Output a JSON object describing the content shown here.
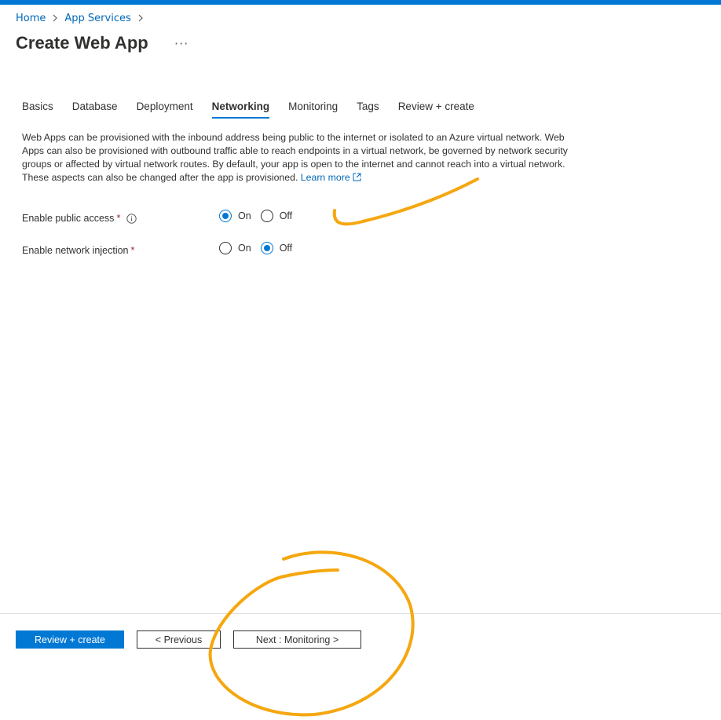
{
  "breadcrumb": {
    "home": "Home",
    "app_services": "App Services",
    "sep": ">"
  },
  "page": {
    "title": "Create Web App",
    "more": "···"
  },
  "tabs": [
    {
      "label": "Basics"
    },
    {
      "label": "Database"
    },
    {
      "label": "Deployment"
    },
    {
      "label": "Networking",
      "active": true
    },
    {
      "label": "Monitoring"
    },
    {
      "label": "Tags"
    },
    {
      "label": "Review + create"
    }
  ],
  "description": {
    "text": "Web Apps can be provisioned with the inbound address being public to the internet or isolated to an Azure virtual network. Web Apps can also be provisioned with outbound traffic able to reach endpoints in a virtual network, be governed by network security groups or affected by virtual network routes. By default, your app is open to the internet and cannot reach into a virtual network. These aspects can also be changed after the app is provisioned.",
    "learn_more": "Learn more"
  },
  "fields": {
    "public_access": {
      "label": "Enable public access",
      "required": "*",
      "on": "On",
      "off": "Off",
      "selected": "On"
    },
    "network_injection": {
      "label": "Enable network injection",
      "required": "*",
      "on": "On",
      "off": "Off",
      "selected": "Off"
    }
  },
  "footer": {
    "review_create": "Review + create",
    "previous": "< Previous",
    "next": "Next : Monitoring >"
  },
  "colors": {
    "accent": "#0078d4",
    "link": "#0067b8",
    "annotation": "#f5a70f",
    "required": "#a4262c"
  },
  "icons": [
    "chevron-right-icon",
    "info-icon",
    "external-link-icon"
  ]
}
